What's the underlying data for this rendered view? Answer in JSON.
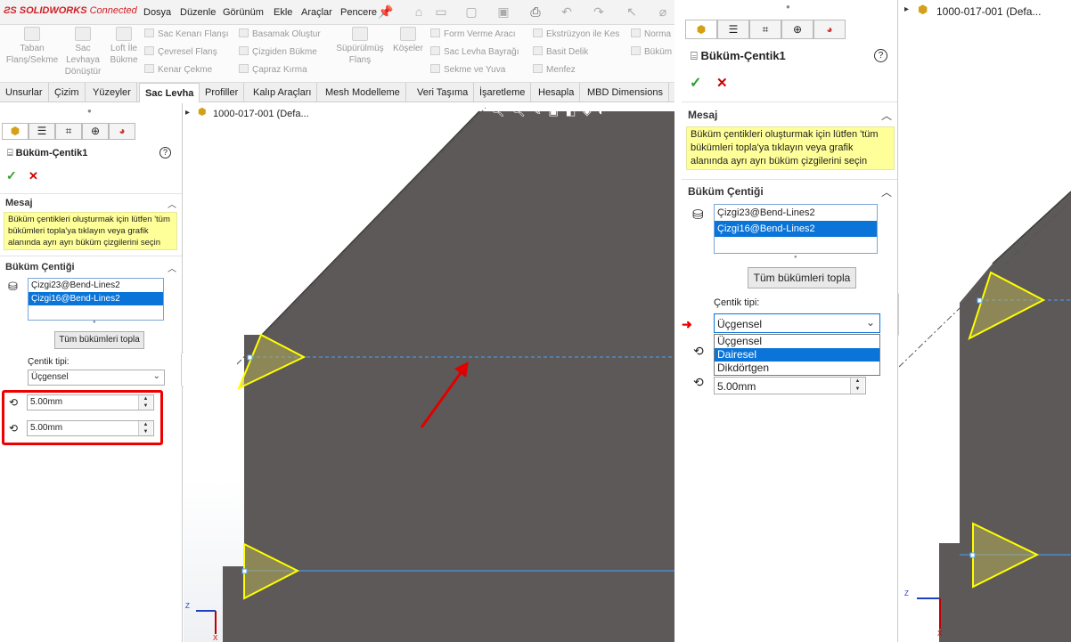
{
  "app": {
    "brand": "SOLIDWORKS",
    "brand_suffix": "Connected"
  },
  "menus": [
    "Dosya",
    "Düzenle",
    "Görünüm",
    "Ekle",
    "Araçlar",
    "Pencere"
  ],
  "ribbon": {
    "big": [
      {
        "label": "Taban Flanş/Sekme"
      },
      {
        "label": "Sac Levhaya Dönüştür"
      },
      {
        "label": "Loft İle Bükme"
      }
    ],
    "small_col1": [
      "Sac Kenarı Flanşı",
      "Çevresel Flanş",
      "Kenar Çekme"
    ],
    "small_col2": [
      "Basamak Oluştur",
      "Çizgiden Bükme",
      "Çapraz Kırma"
    ],
    "big2": [
      {
        "label": "Süpürülmüş Flanş"
      },
      {
        "label": "Köşeler"
      }
    ],
    "small_col3": [
      "Form Verme Aracı",
      "Sac Levha Bayrağı",
      "Sekme ve Yuva"
    ],
    "small_col4": [
      "Ekstrüzyon ile Kes",
      "Basit Delik",
      "Menfez"
    ],
    "small_col5": [
      "Norma",
      "Büküm"
    ]
  },
  "tabs": [
    "Unsurlar",
    "Çizim",
    "Yüzeyler",
    "Sac Levha",
    "Profiller",
    "Kalıp Araçları",
    "Mesh Modelleme",
    "Veri Taşıma",
    "İşaretleme",
    "Hesapla",
    "MBD Dimensions"
  ],
  "active_tab": "Sac Levha",
  "tree": {
    "root": "1000-017-001 (Defa..."
  },
  "feature": {
    "title": "Büküm-Çentik1",
    "help": "?",
    "ok": "✓",
    "cancel": "✕",
    "message_header": "Mesaj",
    "message": "Büküm çentikleri oluşturmak için lütfen 'tüm bükümleri topla'ya tıklayın veya grafik alanında ayrı ayrı büküm çizgilerini seçin",
    "section_header": "Büküm Çentiği",
    "bend_lines": [
      "Çizgi23@Bend-Lines2",
      "Çizgi16@Bend-Lines2"
    ],
    "selected_bend_line": 1,
    "collect_all_button": "Tüm bükümleri topla",
    "notch_type_label": "Çentik tipi:",
    "notch_type_value": "Üçgensel",
    "notch_type_options": [
      "Üçgensel",
      "Dairesel",
      "Dikdörtgen"
    ],
    "notch_type_highlighted": "Dairesel",
    "width": "5.00mm",
    "depth": "5.00mm"
  },
  "colors": {
    "accent_red": "#e00000",
    "selection_blue": "#0a74d8",
    "model_gray": "#5c5958",
    "notch_yellow": "#ffff00",
    "message_bg": "#ffff99",
    "ok_green": "#2f9e2f"
  },
  "axes": {
    "z": "Z",
    "x": "X"
  }
}
